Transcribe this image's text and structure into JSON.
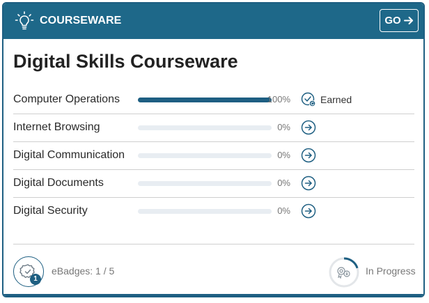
{
  "header": {
    "title": "COURSEWARE",
    "go_label": "GO",
    "icon": "lightbulb-icon"
  },
  "main": {
    "title": "Digital Skills Courseware",
    "modules": [
      {
        "label": "Computer Operations",
        "progress": 100,
        "percent_text": "100%",
        "status": "Earned",
        "icon": "earned-check-icon"
      },
      {
        "label": "Internet Browsing",
        "progress": 0,
        "percent_text": "0%",
        "icon": "arrow-right-circle-icon"
      },
      {
        "label": "Digital Communication",
        "progress": 0,
        "percent_text": "0%",
        "icon": "arrow-right-circle-icon"
      },
      {
        "label": "Digital Documents",
        "progress": 0,
        "percent_text": "0%",
        "icon": "arrow-right-circle-icon"
      },
      {
        "label": "Digital Security",
        "progress": 0,
        "percent_text": "0%",
        "icon": "arrow-right-circle-icon"
      }
    ]
  },
  "footer": {
    "badge_count": "1",
    "ebadges_text": "eBadges: 1 / 5",
    "status_text": "In Progress",
    "status_progress": 0.2
  },
  "colors": {
    "accent": "#1e6889",
    "track": "#e8edf2"
  }
}
